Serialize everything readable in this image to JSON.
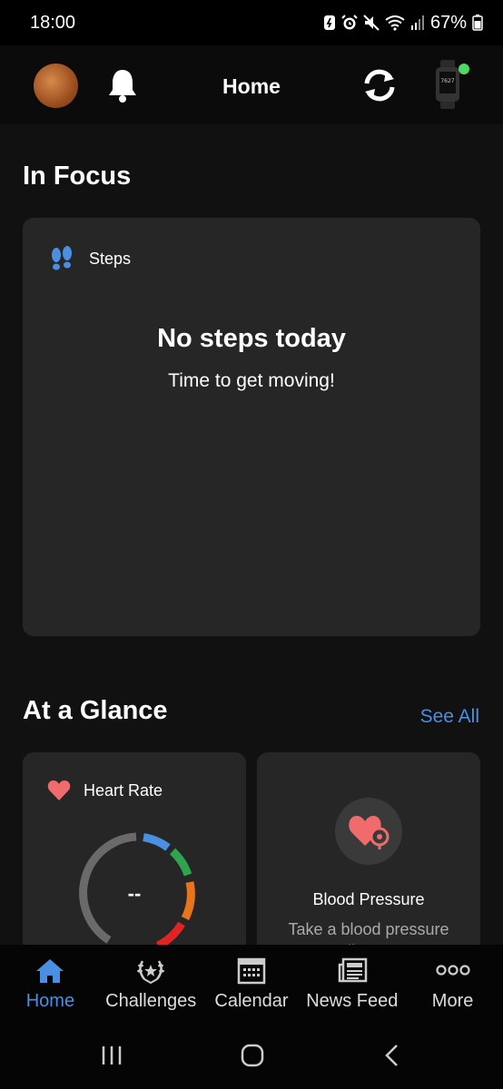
{
  "status_bar": {
    "time": "18:00",
    "battery": "67%"
  },
  "app_bar": {
    "title": "Home"
  },
  "in_focus": {
    "section_title": "In Focus",
    "card": {
      "label": "Steps",
      "headline": "No steps today",
      "subtext": "Time to get moving!"
    }
  },
  "at_a_glance": {
    "section_title": "At a Glance",
    "see_all": "See All",
    "heart_rate": {
      "label": "Heart Rate",
      "value": "--"
    },
    "blood_pressure": {
      "title": "Blood Pressure",
      "description": "Take a blood pressure reading to get"
    }
  },
  "bottom_nav": {
    "items": [
      {
        "label": "Home",
        "icon": "home-icon",
        "active": true
      },
      {
        "label": "Challenges",
        "icon": "laurel-icon",
        "active": false
      },
      {
        "label": "Calendar",
        "icon": "calendar-icon",
        "active": false
      },
      {
        "label": "News Feed",
        "icon": "newspaper-icon",
        "active": false
      },
      {
        "label": "More",
        "icon": "more-icon",
        "active": false
      }
    ]
  },
  "colors": {
    "accent": "#4a90e2",
    "heart": "#f06b6b",
    "card_bg": "#262626",
    "connected_dot": "#4cd964"
  }
}
